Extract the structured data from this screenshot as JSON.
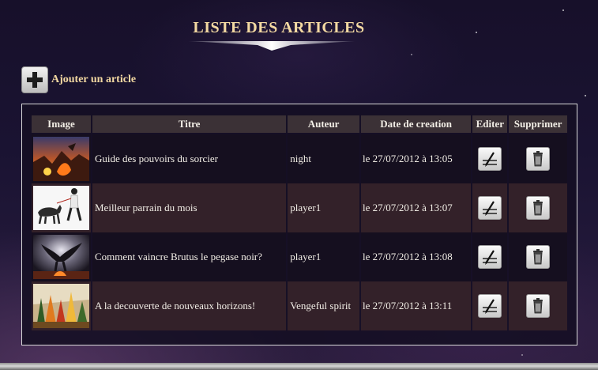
{
  "page": {
    "title": "LISTE DES ARTICLES"
  },
  "actions": {
    "add_article_label": "Ajouter un article",
    "add_icon": "plus-icon"
  },
  "table": {
    "headers": {
      "image": "Image",
      "titre": "Titre",
      "auteur": "Auteur",
      "date": "Date de creation",
      "editer": "Editer",
      "supprimer": "Supprimer"
    },
    "rows": [
      {
        "titre": "Guide des pouvoirs du sorcier",
        "auteur": "night",
        "date": "le 27/07/2012 à 13:05",
        "thumb_icon": "fire-landscape-thumbnail"
      },
      {
        "titre": "Meilleur parrain du mois",
        "auteur": "player1",
        "date": "le 27/07/2012 à 13:07",
        "thumb_icon": "man-walking-dog-thumbnail"
      },
      {
        "titre": "Comment vaincre Brutus le pegase noir?",
        "auteur": "player1",
        "date": "le 27/07/2012 à 13:08",
        "thumb_icon": "dark-pegasus-thumbnail"
      },
      {
        "titre": "A la decouverte de nouveaux horizons!",
        "auteur": "Vengeful spirit",
        "date": "le 27/07/2012 à 13:11",
        "thumb_icon": "autumn-forest-thumbnail"
      }
    ],
    "edit_icon": "edit-pen-icon",
    "delete_icon": "trash-icon"
  },
  "colors": {
    "title": "#f3d9a2",
    "header_bg": "#3b3136",
    "row_dark": "#150f1f",
    "row_plum": "#332129",
    "frame_border": "#d8d8d8"
  }
}
